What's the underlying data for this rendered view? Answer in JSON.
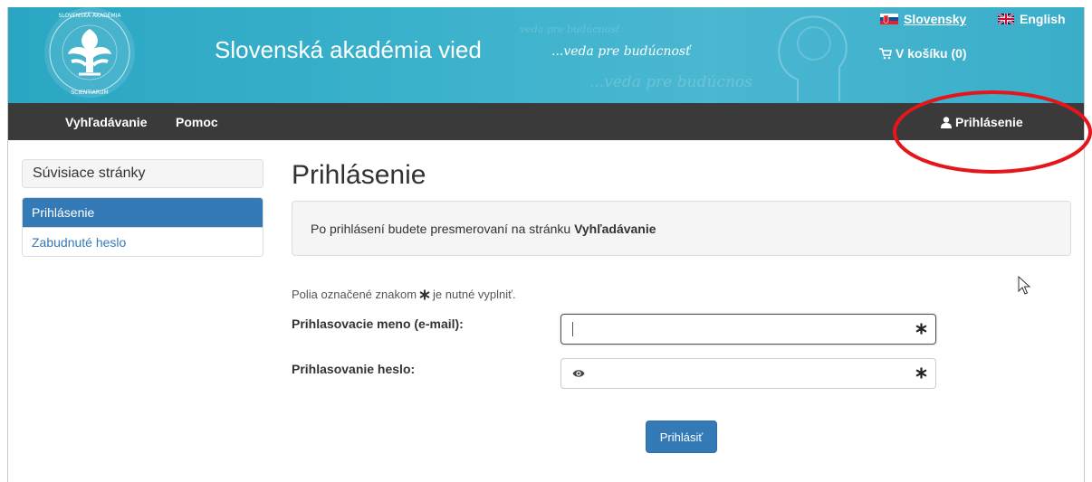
{
  "header": {
    "site_title": "Slovenská akadémia vied",
    "slogan": "...veda pre budúcnosť",
    "slogan_ghost_1": "veda pre budúcnosť",
    "slogan_ghost_2": "...veda pre budúcnos",
    "lang_sk": "Slovensky",
    "lang_en": "English",
    "cart_label": "V košíku (0)",
    "logo_ring_text": "SLOVENSKÁ AKADÉMIA VIED • ACADEMIA SCIENTIARUM SLOVACA"
  },
  "nav": {
    "search": "Vyhľadávanie",
    "help": "Pomoc",
    "login": "Prihlásenie"
  },
  "sidebar": {
    "title": "Súvisiace stránky",
    "items": [
      {
        "label": "Prihlásenie",
        "active": true
      },
      {
        "label": "Zabudnuté heslo",
        "active": false
      }
    ]
  },
  "main": {
    "title": "Prihlásenie",
    "info_text": "Po prihlásení budete presmerovaní na stránku",
    "info_target": "Vyhľadávanie",
    "hint_before": "Polia označené znakom",
    "hint_after": "je nutné vyplniť.",
    "username_label": "Prihlasovacie meno (e-mail):",
    "password_label": "Prihlasovanie heslo:",
    "username_value": "",
    "password_value": "",
    "submit_label": "Prihlásiť"
  },
  "colors": {
    "header_bg": "#3bb2cc",
    "nav_bg": "#3a3a3a",
    "primary": "#337ab7",
    "annotation": "#e3161c"
  }
}
